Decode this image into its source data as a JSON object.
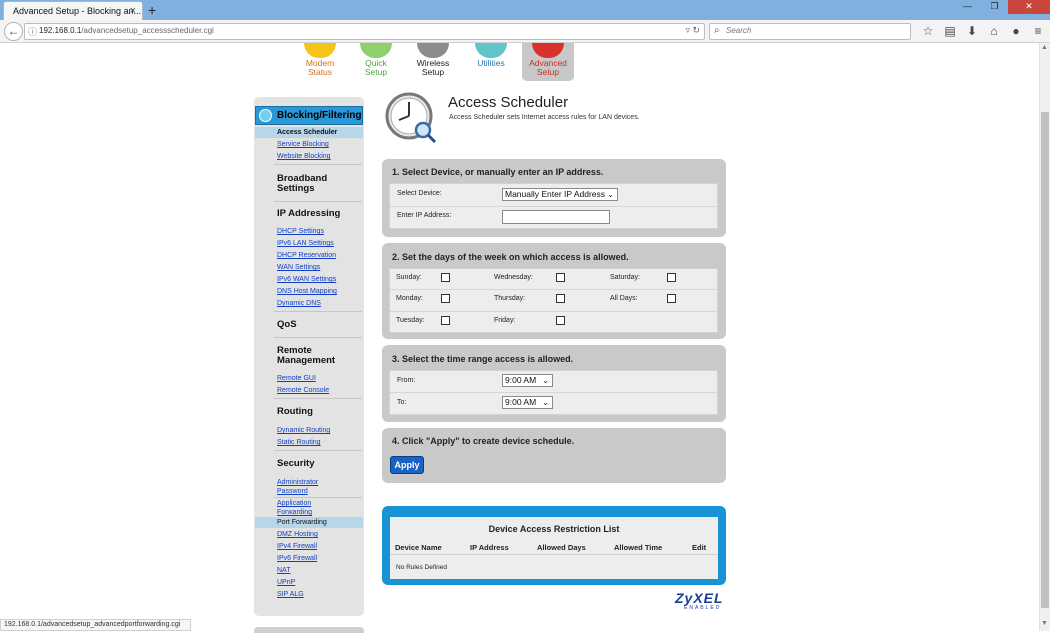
{
  "browser": {
    "tab_title": "Advanced Setup - Blocking an...",
    "tab_close": "×",
    "new_tab": "+",
    "url_host": "192.168.0.1",
    "url_path": "/advancedsetup_accessscheduler.cgi",
    "search_placeholder": "Search",
    "status_url": "192.168.0.1/advancedsetup_advancedportforwarding.cgi"
  },
  "topnav": [
    {
      "label1": "Modem",
      "label2": "Status"
    },
    {
      "label1": "Quick",
      "label2": "Setup"
    },
    {
      "label1": "Wireless",
      "label2": "Setup"
    },
    {
      "label1": "Utilities",
      "label2": ""
    },
    {
      "label1": "Advanced",
      "label2": "Setup"
    }
  ],
  "sidebar": {
    "header": "Blocking/Filtering",
    "blocking_links": [
      "Access Scheduler",
      "Service Blocking",
      "Website Blocking"
    ],
    "broadband": "Broadband Settings",
    "ip_addressing": "IP Addressing",
    "ip_links": [
      "DHCP Settings",
      "IPv6 LAN Settings",
      "DHCP Reservation",
      "WAN Settings",
      "IPv6 WAN Settings",
      "DNS Host Mapping",
      "Dynamic DNS"
    ],
    "qos": "QoS",
    "remote_management": "Remote Management",
    "remote_links": [
      "Remote GUI",
      "Remote Console"
    ],
    "routing": "Routing",
    "routing_links": [
      "Dynamic Routing",
      "Static Routing"
    ],
    "security": "Security",
    "security_links": [
      "Administrator Password",
      "Application Forwarding",
      "Port Forwarding",
      "DMZ Hosting",
      "IPv4 Firewall",
      "IPv6 Firewall",
      "NAT",
      "UPnP",
      "SIP ALG"
    ]
  },
  "header": {
    "title": "Access Scheduler",
    "description": "Access Scheduler sets Internet access rules for LAN devices."
  },
  "step1": {
    "title": "1. Select Device, or manually enter an IP address.",
    "select_label": "Select Device:",
    "select_value": "Manually Enter IP Address",
    "ip_label": "Enter IP Address:",
    "ip_value": ""
  },
  "step2": {
    "title": "2. Set the days of the week on which access is allowed.",
    "days": [
      "Sunday:",
      "Wednesday:",
      "Saturday:",
      "Monday:",
      "Thursday:",
      "All Days:",
      "Tuesday:",
      "Friday:"
    ]
  },
  "step3": {
    "title": "3. Select the time range access is allowed.",
    "from_label": "From:",
    "from_value": "9:00 AM",
    "to_label": "To:",
    "to_value": "9:00 AM"
  },
  "step4": {
    "title": "4. Click \"Apply\" to create device schedule.",
    "apply_label": "Apply"
  },
  "restriction_list": {
    "title": "Device Access Restriction List",
    "columns": [
      "Device Name",
      "IP Address",
      "Allowed Days",
      "Allowed Time",
      "Edit"
    ],
    "empty_text": "No Rules Defined"
  },
  "logo": {
    "main": "ZyXEL",
    "sub": "ENABLED"
  },
  "colors": {
    "accent_blue": "#1893d6",
    "link_blue": "#1140c7",
    "panel_gray": "#c9c9c9"
  }
}
